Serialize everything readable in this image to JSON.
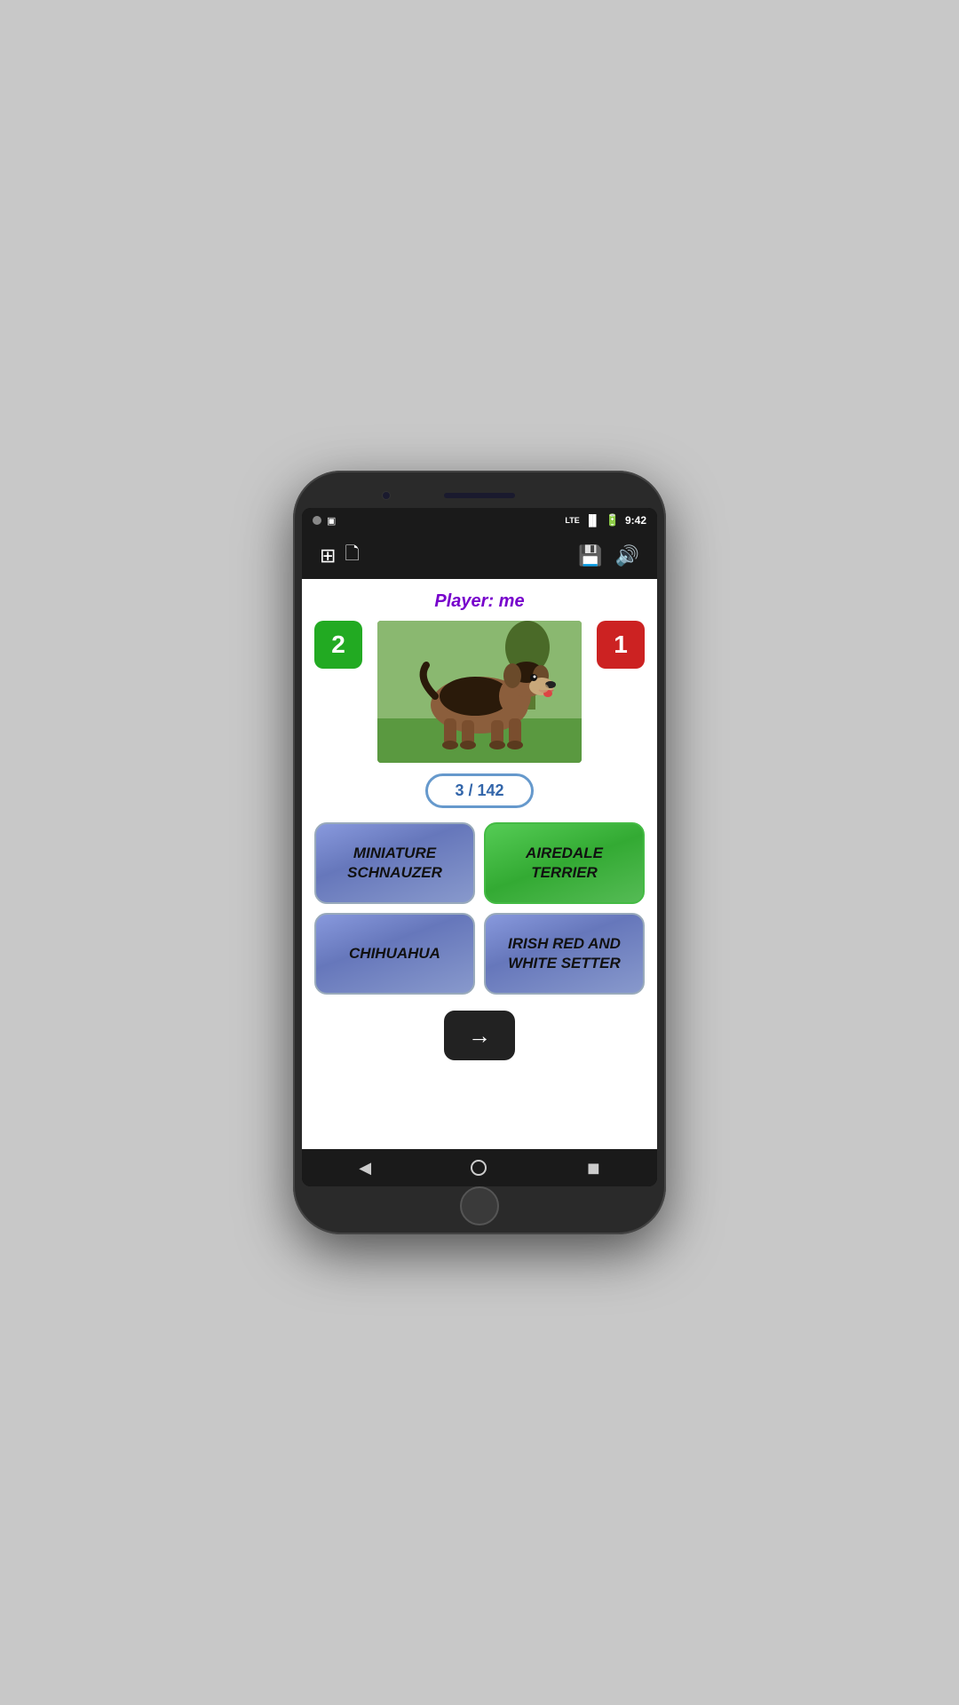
{
  "status": {
    "time": "9:42",
    "battery_icon": "🔋",
    "lte": "LTE"
  },
  "toolbar": {
    "icon_layers": "⊞",
    "icon_doc": "📄",
    "icon_save": "💾",
    "icon_sound": "🔊"
  },
  "app": {
    "player_label": "Player:  me",
    "score_left": "2",
    "score_right": "1",
    "counter": "3 / 142",
    "answers": [
      {
        "id": "miniature-schnauzer",
        "label": "MINIATURE\nSCHNAUZER",
        "style": "blue"
      },
      {
        "id": "airedale-terrier",
        "label": "AIREDALE\nTERRIER",
        "style": "green"
      },
      {
        "id": "chihuahua",
        "label": "CHIHUAHUA",
        "style": "blue"
      },
      {
        "id": "irish-red-white-setter",
        "label": "IRISH RED AND\nWHITE SETTER",
        "style": "blue"
      }
    ],
    "next_button_label": "→"
  }
}
